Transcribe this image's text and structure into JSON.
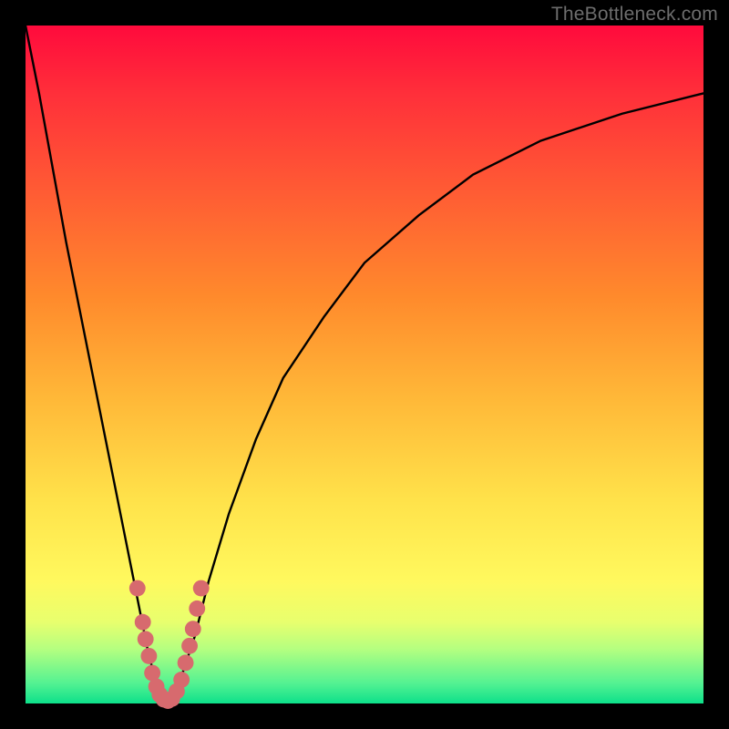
{
  "watermark": "TheBottleneck.com",
  "chart_data": {
    "type": "line",
    "title": "",
    "xlabel": "",
    "ylabel": "",
    "xlim": [
      0,
      100
    ],
    "ylim": [
      0,
      100
    ],
    "grid": false,
    "series": [
      {
        "name": "curve",
        "x": [
          0,
          2,
          4,
          6,
          8,
          10,
          12,
          14,
          16,
          17,
          18,
          19,
          20,
          21,
          22,
          23,
          25,
          27,
          30,
          34,
          38,
          44,
          50,
          58,
          66,
          76,
          88,
          100
        ],
        "y": [
          100,
          90,
          79,
          68,
          58,
          48,
          38,
          28,
          18,
          13,
          8,
          4,
          1,
          0,
          1,
          4,
          10,
          18,
          28,
          39,
          48,
          57,
          65,
          72,
          78,
          83,
          87,
          90
        ]
      }
    ],
    "markers": {
      "name": "dots-near-minimum",
      "color": "#d76a6e",
      "radius_pct": 1.2,
      "points": [
        {
          "x": 16.5,
          "y": 17
        },
        {
          "x": 17.3,
          "y": 12
        },
        {
          "x": 17.7,
          "y": 9.5
        },
        {
          "x": 18.2,
          "y": 7
        },
        {
          "x": 18.7,
          "y": 4.5
        },
        {
          "x": 19.3,
          "y": 2.5
        },
        {
          "x": 19.8,
          "y": 1.3
        },
        {
          "x": 20.4,
          "y": 0.6
        },
        {
          "x": 21.0,
          "y": 0.4
        },
        {
          "x": 21.6,
          "y": 0.7
        },
        {
          "x": 22.3,
          "y": 1.8
        },
        {
          "x": 23.0,
          "y": 3.5
        },
        {
          "x": 23.6,
          "y": 6
        },
        {
          "x": 24.2,
          "y": 8.5
        },
        {
          "x": 24.7,
          "y": 11
        },
        {
          "x": 25.3,
          "y": 14
        },
        {
          "x": 25.9,
          "y": 17
        }
      ]
    }
  }
}
